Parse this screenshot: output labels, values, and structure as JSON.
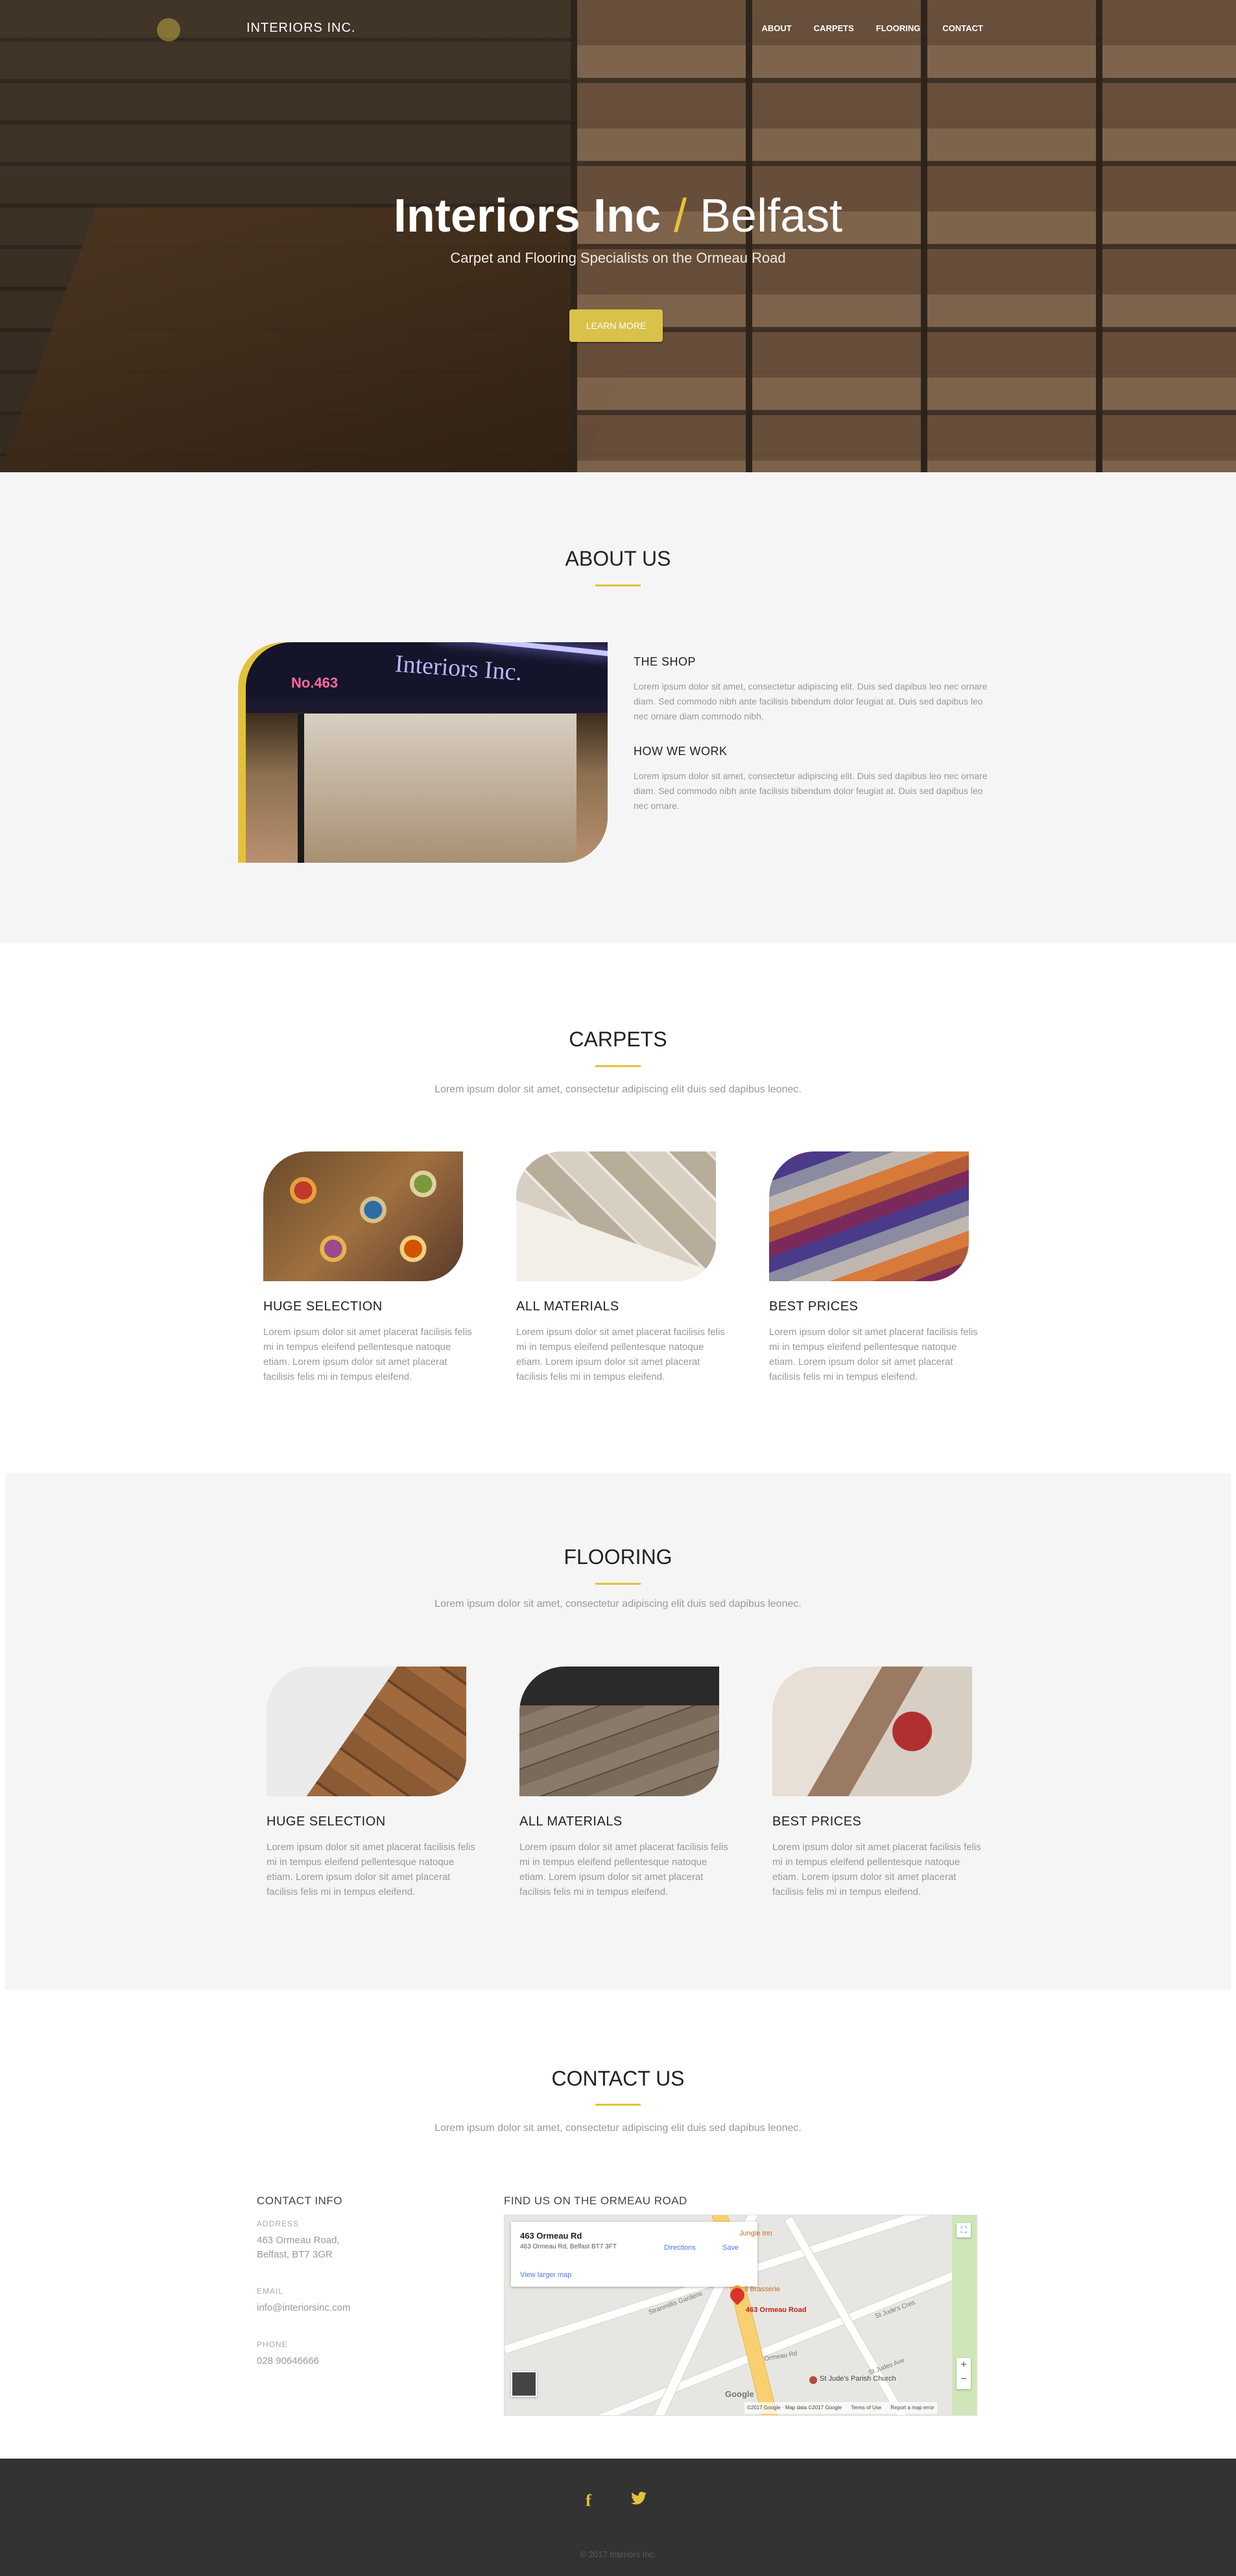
{
  "brand": "INTERIORS INC.",
  "nav": [
    "ABOUT",
    "CARPETS",
    "FLOORING",
    "CONTACT"
  ],
  "hero": {
    "title_bold": "Interiors Inc",
    "title_slash": "/",
    "title_light": "Belfast",
    "subtitle": "Carpet and Flooring Specialists on the Ormeau Road",
    "button": "LEARN MORE"
  },
  "about": {
    "title": "ABOUT US",
    "image_sign": "Interiors Inc.",
    "image_number": "No.463",
    "blocks": [
      {
        "heading": "THE SHOP",
        "text": "Lorem ipsum dolor sit amet, consectetur adipiscing elit. Duis sed dapibus leo nec ornare diam. Sed commodo nibh ante facilisis bibendum dolor feugiat at. Duis sed dapibus leo nec ornare diam commodo nibh."
      },
      {
        "heading": "HOW WE WORK",
        "text": "Lorem ipsum dolor sit amet, consectetur adipiscing elit. Duis sed dapibus leo nec ornare diam. Sed commodo nibh ante facilisis bibendum dolor feugiat at. Duis sed dapibus leo nec ornare."
      }
    ]
  },
  "carpets": {
    "title": "CARPETS",
    "lead": "Lorem ipsum dolor sit amet, consectetur adipiscing elit duis sed dapibus leonec.",
    "cards": [
      {
        "heading": "HUGE SELECTION",
        "text": "Lorem ipsum dolor sit amet placerat facilisis felis mi in tempus eleifend pellentesque natoque etiam. Lorem ipsum dolor sit amet placerat facilisis felis mi in tempus eleifend."
      },
      {
        "heading": "ALL MATERIALS",
        "text": "Lorem ipsum dolor sit amet placerat facilisis felis mi in tempus eleifend pellentesque natoque etiam. Lorem ipsum dolor sit amet placerat facilisis felis mi in tempus eleifend."
      },
      {
        "heading": "BEST PRICES",
        "text": "Lorem ipsum dolor sit amet placerat facilisis felis mi in tempus eleifend pellentesque natoque etiam. Lorem ipsum dolor sit amet placerat facilisis felis mi in tempus eleifend."
      }
    ]
  },
  "flooring": {
    "title": "FLOORING",
    "lead": "Lorem ipsum dolor sit amet, consectetur adipiscing elit duis sed dapibus leonec.",
    "cards": [
      {
        "heading": "HUGE SELECTION",
        "text": "Lorem ipsum dolor sit amet placerat facilisis felis mi in tempus eleifend pellentesque natoque etiam. Lorem ipsum dolor sit amet placerat facilisis felis mi in tempus eleifend."
      },
      {
        "heading": "ALL MATERIALS",
        "text": "Lorem ipsum dolor sit amet placerat facilisis felis mi in tempus eleifend pellentesque natoque etiam. Lorem ipsum dolor sit amet placerat facilisis felis mi in tempus eleifend."
      },
      {
        "heading": "BEST PRICES",
        "text": "Lorem ipsum dolor sit amet placerat facilisis felis mi in tempus eleifend pellentesque natoque etiam. Lorem ipsum dolor sit amet placerat facilisis felis mi in tempus eleifend."
      }
    ]
  },
  "contact": {
    "title": "CONTACT US",
    "lead": "Lorem ipsum dolor sit amet, consectetur adipiscing elit duis sed dapibus leonec.",
    "info_heading": "CONTACT INFO",
    "address_label": "ADDRESS",
    "address_line1": "463 Ormeau Road,",
    "address_line2": "Belfast, BT7 3GR",
    "email_label": "EMAIL",
    "email": "info@interiorsinc.com",
    "phone_label": "PHONE",
    "phone": "028 90646666",
    "map_heading": "FIND US ON THE ORMEAU ROAD"
  },
  "map": {
    "place_name": "463 Ormeau Rd",
    "place_address": "463 Ormeau Rd, Belfast BT7 3FT",
    "directions": "Directions",
    "save": "Save",
    "larger_map": "View larger map",
    "pin_label": "463 Ormeau Road",
    "poi_1": "Jungle Inn",
    "poi_2": "Il Brasserie",
    "poi_3": "St Jude's Parish Church",
    "street_1": "Stranmillis Gardens",
    "street_2": "St Judes Ave",
    "street_3": "Ormeau Rd",
    "street_4": "St Jude's Cres",
    "attribution": "©2017 Google · Map data ©2017 Google",
    "terms": "Terms of Use",
    "report": "Report a map error",
    "google": "Google",
    "zoom_in": "+",
    "zoom_out": "−"
  },
  "footer": {
    "copyright": "© 2017 Interiors Inc."
  }
}
